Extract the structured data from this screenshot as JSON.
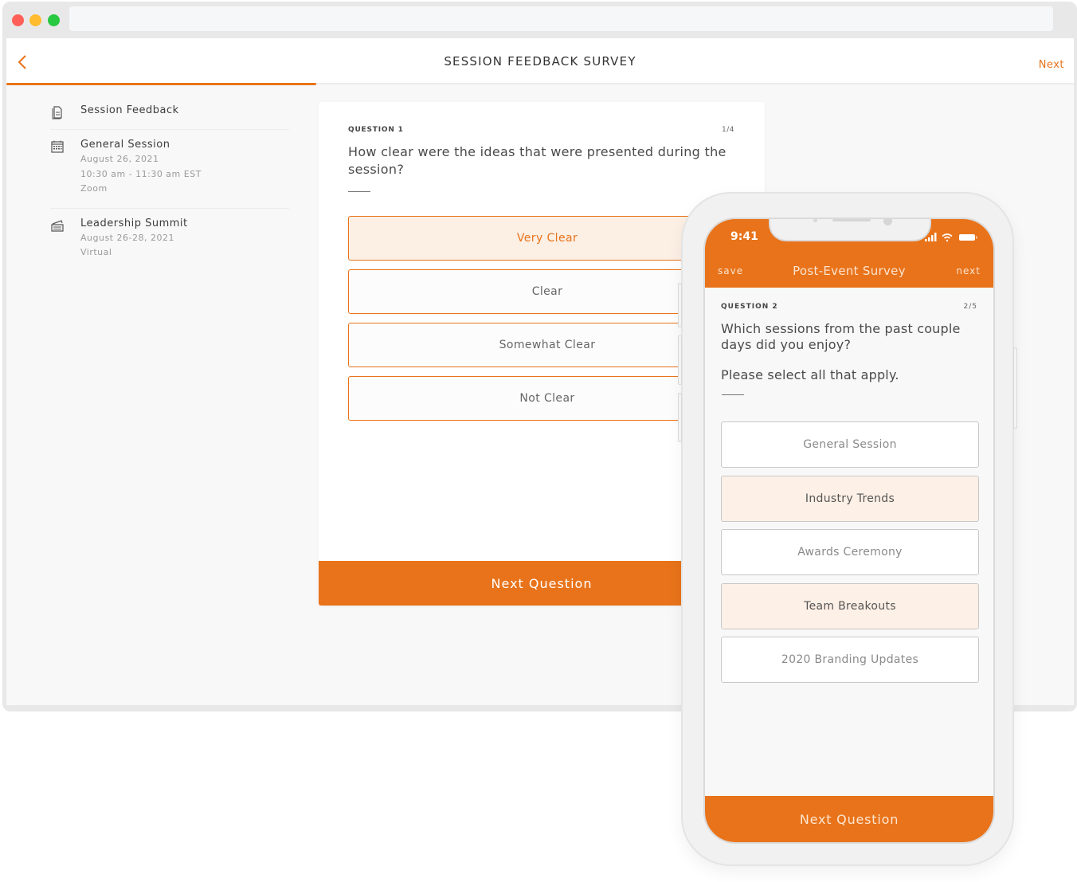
{
  "window": {
    "controls": [
      "close",
      "minimize",
      "maximize"
    ],
    "url": ""
  },
  "header": {
    "back_icon": "chevron-left-icon",
    "title": "SESSION FEEDBACK SURVEY",
    "next_label": "Next",
    "progress_percent": 29
  },
  "colors": {
    "accent": "#e8731a",
    "selected_bg": "#fcefe4",
    "page_bg": "#f8f8f8"
  },
  "sidebar": {
    "items": [
      {
        "icon": "document-icon",
        "title": "Session Feedback",
        "details": []
      },
      {
        "icon": "calendar-icon",
        "title": "General Session",
        "details": [
          "August 26, 2021",
          "10:30 am - 11:30 am EST",
          "Zoom"
        ]
      },
      {
        "icon": "tickets-icon",
        "title": "Leadership Summit",
        "details": [
          "August 26-28, 2021",
          "Virtual"
        ]
      }
    ]
  },
  "desktop_question": {
    "label": "QUESTION 1",
    "count": "1/4",
    "text": "How clear were the ideas that were presented during the session?",
    "options": [
      {
        "label": "Very Clear",
        "selected": true
      },
      {
        "label": "Clear",
        "selected": false
      },
      {
        "label": "Somewhat Clear",
        "selected": false
      },
      {
        "label": "Not Clear",
        "selected": false
      }
    ],
    "next_button": "Next Question"
  },
  "phone": {
    "status_time": "9:41",
    "status_icons": [
      "signal-icon",
      "wifi-icon",
      "battery-icon"
    ],
    "save_label": "save",
    "title": "Post-Event Survey",
    "next_label": "next",
    "question": {
      "label": "QUESTION 2",
      "count": "2/5",
      "text": "Which sessions from the past couple days did you enjoy?",
      "hint": "Please select all that apply.",
      "options": [
        {
          "label": "General Session",
          "selected": false
        },
        {
          "label": "Industry Trends",
          "selected": true
        },
        {
          "label": "Awards Ceremony",
          "selected": false
        },
        {
          "label": "Team Breakouts",
          "selected": true
        },
        {
          "label": "2020 Branding Updates",
          "selected": false
        }
      ]
    },
    "next_button": "Next Question"
  }
}
